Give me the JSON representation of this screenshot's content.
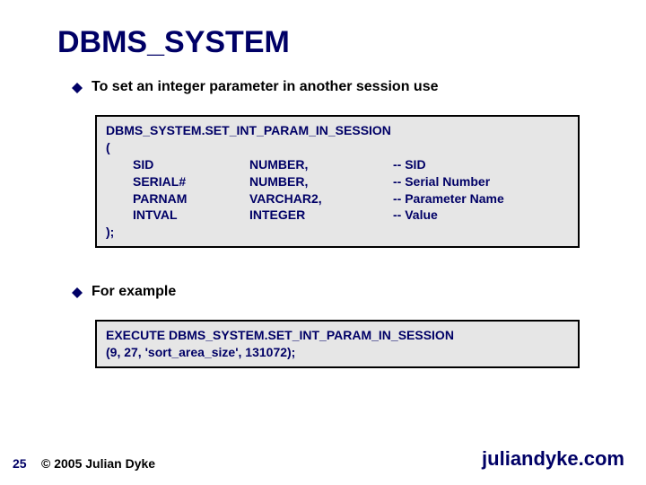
{
  "title": "DBMS_SYSTEM",
  "bullets": [
    {
      "text": "To set an integer parameter in another session use"
    },
    {
      "text": "For example"
    }
  ],
  "code1": {
    "heading": "DBMS_SYSTEM.SET_INT_PARAM_IN_SESSION",
    "open": "(",
    "params": [
      {
        "name": "SID",
        "type": "NUMBER,",
        "comment": "-- SID"
      },
      {
        "name": "SERIAL#",
        "type": "NUMBER,",
        "comment": "-- Serial Number"
      },
      {
        "name": "PARNAM",
        "type": "VARCHAR2,",
        "comment": "-- Parameter Name"
      },
      {
        "name": "INTVAL",
        "type": "INTEGER",
        "comment": "-- Value"
      }
    ],
    "close": ");"
  },
  "code2": {
    "line1": "EXECUTE DBMS_SYSTEM.SET_INT_PARAM_IN_SESSION",
    "line2": "(9, 27, 'sort_area_size', 131072);"
  },
  "footer": {
    "page": "25",
    "copyright": "© 2005 Julian Dyke",
    "website": "juliandyke.com"
  },
  "colors": {
    "accent": "#000066"
  }
}
